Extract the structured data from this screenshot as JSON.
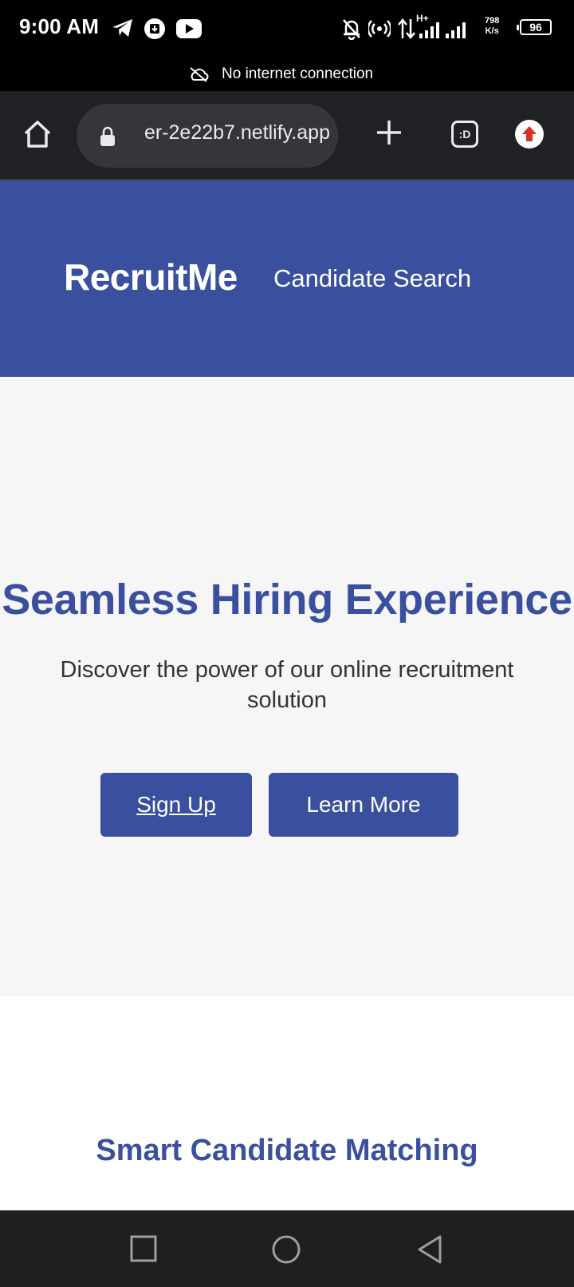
{
  "status_bar": {
    "time": "9:00 AM",
    "network_speed_value": "798",
    "network_speed_unit": "K/s",
    "battery": "96",
    "network_type": "H+",
    "icons": [
      "telegram-icon",
      "download-icon",
      "youtube-icon",
      "bell-off-icon",
      "hotspot-icon",
      "data-arrows-icon",
      "signal-icon",
      "battery-icon"
    ]
  },
  "offline_banner": {
    "text": "No internet connection",
    "icon": "cloud-off-icon"
  },
  "browser": {
    "url": "er-2e22b7.netlify.app",
    "tab_label": ":D",
    "icons": [
      "home-icon",
      "lock-icon",
      "plus-icon",
      "tabs-icon",
      "update-icon"
    ],
    "accent_color": "#d93025"
  },
  "site": {
    "brand": "RecruitMe",
    "nav": [
      {
        "label": "Candidate Search"
      }
    ],
    "hero": {
      "title": "Seamless Hiring Experience",
      "subtitle": "Discover the power of our online recruitment solution",
      "buttons": [
        {
          "label": "Sign Up"
        },
        {
          "label": "Learn More"
        }
      ]
    },
    "features_title": "Smart Candidate Matching",
    "colors": {
      "primary": "#3a4f9e",
      "hero_bg": "#f6f6f6",
      "text": "#333333"
    }
  },
  "nav_bar": {
    "buttons": [
      "recents-icon",
      "home-icon",
      "back-icon"
    ]
  }
}
